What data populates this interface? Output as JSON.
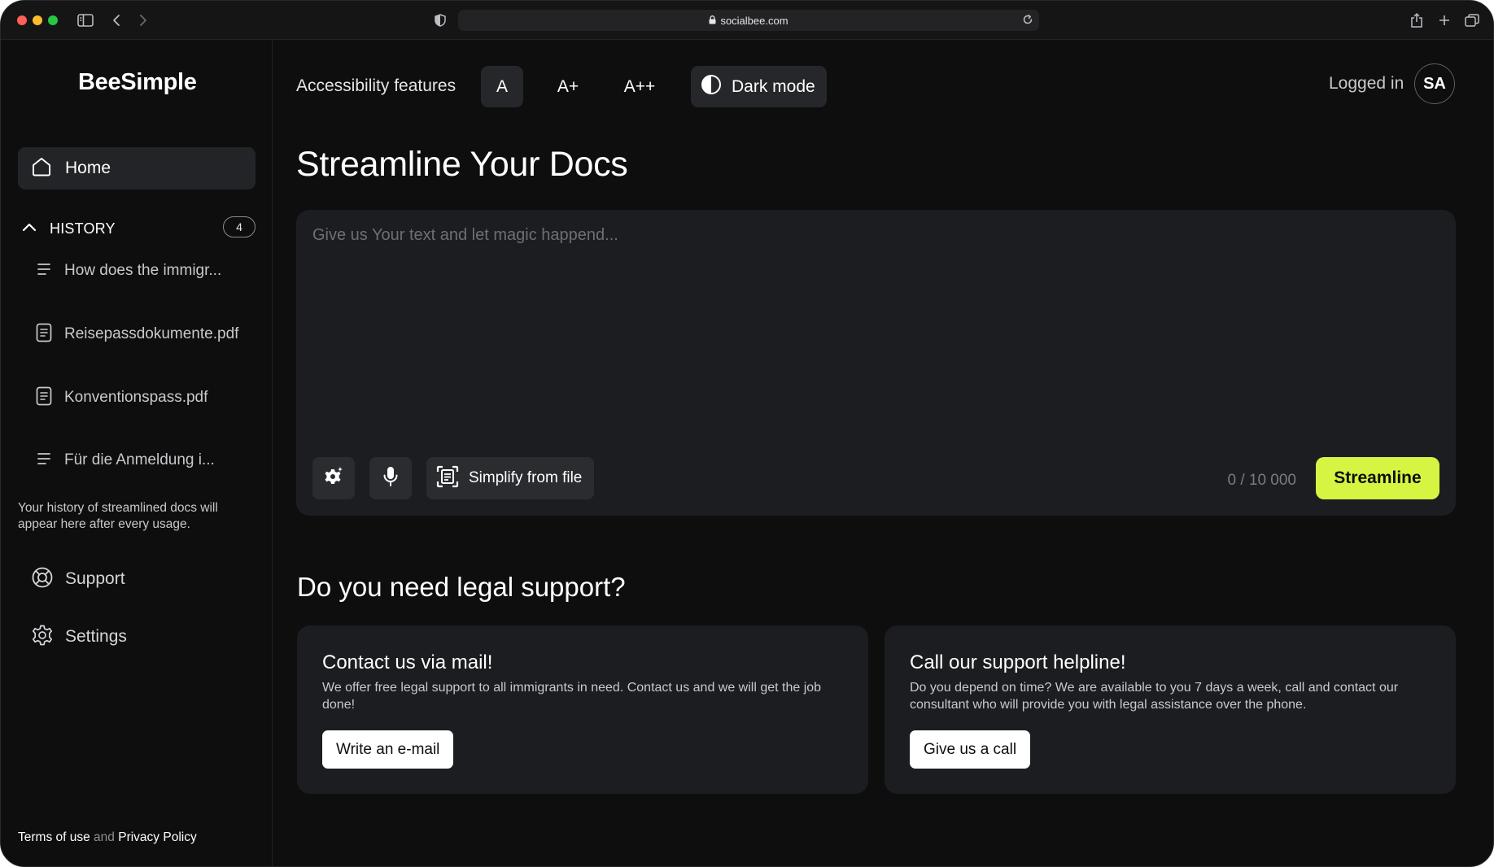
{
  "browser": {
    "url": "socialbee.com"
  },
  "sidebar": {
    "logo": "BeeSimple",
    "home_label": "Home",
    "history": {
      "title": "HISTORY",
      "count": "4",
      "items": [
        {
          "label": "How does the immigr...",
          "icon": "text-lines-icon"
        },
        {
          "label": "Reisepassdokumente.pdf",
          "icon": "document-icon"
        },
        {
          "label": "Konventionspass.pdf",
          "icon": "document-icon"
        },
        {
          "label": "Für die Anmeldung i...",
          "icon": "text-lines-icon"
        }
      ],
      "note": "Your history of streamlined docs will appear here after every usage."
    },
    "support_label": "Support",
    "settings_label": "Settings",
    "footer": {
      "terms": "Terms of use",
      "and": "and",
      "privacy": "Privacy Policy"
    }
  },
  "topbar": {
    "accessibility_label": "Accessibility features",
    "sizes": [
      "A",
      "A+",
      "A++"
    ],
    "active_size": "A",
    "dark_mode_label": "Dark mode",
    "logged_in_label": "Logged in",
    "avatar_initials": "SA"
  },
  "main": {
    "title": "Streamline Your Docs",
    "editor": {
      "placeholder": "Give us Your text and let magic happend...",
      "value": "",
      "simplify_label": "Simplify from file",
      "counter": "0 / 10 000",
      "submit_label": "Streamline"
    },
    "support_section": {
      "title": "Do you need legal support?",
      "cards": [
        {
          "title": "Contact us via mail!",
          "description": "We offer free legal support to all immigrants in need. Contact us and we will get the job done!",
          "button": "Write an e-mail"
        },
        {
          "title": "Call our support helpline!",
          "description": "Do you depend on time? We are available to you 7 days a week, call and contact our consultant who will provide you with legal assistance over the phone.",
          "button": "Give us a call"
        }
      ]
    }
  },
  "colors": {
    "background": "#0e0e0f",
    "surface": "#1c1d20",
    "accent": "#d6f542"
  }
}
